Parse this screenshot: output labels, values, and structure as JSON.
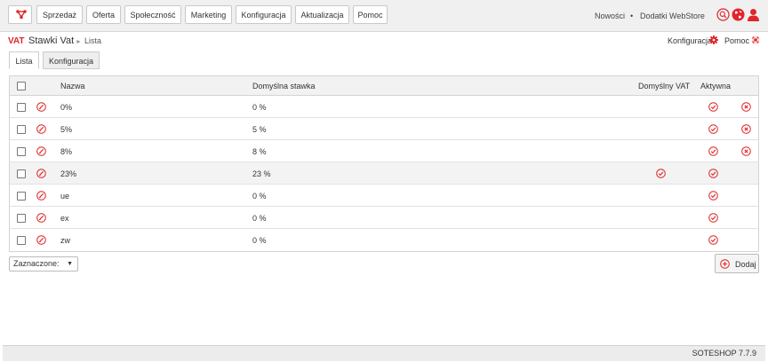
{
  "menu": {
    "items": [
      "Sprzedaż",
      "Oferta",
      "Społeczność",
      "Marketing",
      "Konfiguracja",
      "Aktualizacja",
      "Pomoc"
    ],
    "news": "Nowości",
    "separator": "•",
    "webstore": "Dodatki WebStore"
  },
  "header": {
    "badge": "VAT",
    "title": "Stawki Vat",
    "breadcrumb": "Lista",
    "config_link": "Konfiguracja",
    "help_link": "Pomoc"
  },
  "tabs": [
    "Lista",
    "Konfiguracja"
  ],
  "table": {
    "columns": {
      "name": "Nazwa",
      "rate": "Domyślna stawka",
      "default_vat": "Domyślny VAT",
      "active": "Aktywna"
    },
    "rows": [
      {
        "name": "0%",
        "rate": "0 %",
        "default": false,
        "active": true,
        "deletable": true
      },
      {
        "name": "5%",
        "rate": "5 %",
        "default": false,
        "active": true,
        "deletable": true
      },
      {
        "name": "8%",
        "rate": "8 %",
        "default": false,
        "active": true,
        "deletable": true
      },
      {
        "name": "23%",
        "rate": "23 %",
        "default": true,
        "active": true,
        "deletable": false
      },
      {
        "name": "ue",
        "rate": "0 %",
        "default": false,
        "active": true,
        "deletable": false
      },
      {
        "name": "ex",
        "rate": "0 %",
        "default": false,
        "active": true,
        "deletable": false
      },
      {
        "name": "zw",
        "rate": "0 %",
        "default": false,
        "active": true,
        "deletable": false
      }
    ]
  },
  "bulk": {
    "label": "Zaznaczone:"
  },
  "add_button": {
    "label": "Dodaj"
  },
  "footer": {
    "version": "SOTESHOP 7.7.9"
  },
  "colors": {
    "accent": "#e0262b"
  }
}
